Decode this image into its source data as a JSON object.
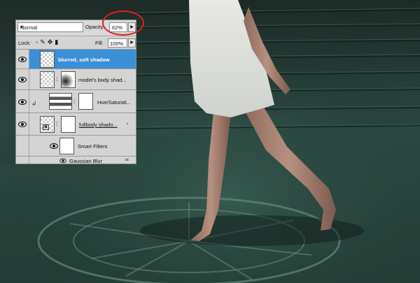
{
  "colors": {
    "selection": "#3b8fd6",
    "panel_bg": "#d4d4d4",
    "annotation": "#e0201b",
    "scene_dark": "#182622",
    "scene_teal": "#3f6b5e"
  },
  "toolbar": {
    "blend_mode": "Normal",
    "opacity_label": "Opacity:",
    "opacity_value": "62%",
    "lock_label": "Lock:",
    "fill_label": "Fill:",
    "fill_value": "100%"
  },
  "layers": [
    {
      "name": "blurred, soft shadow",
      "selected": true,
      "visible": true
    },
    {
      "name": "model's body shad...",
      "selected": false,
      "visible": true
    },
    {
      "name": "Hue/Saturati...",
      "selected": false,
      "visible": true
    },
    {
      "name": "fullbody shado...",
      "selected": false,
      "visible": true
    },
    {
      "name": "Smart Filters",
      "selected": false,
      "visible": true
    },
    {
      "name": "Gaussian Blur",
      "selected": false,
      "visible": true
    }
  ],
  "icons": {
    "lock_icons": [
      "lock-transparent-icon",
      "lock-paint-icon",
      "lock-move-icon",
      "lock-all-icon"
    ],
    "eye": "eye-icon",
    "chain": "chain-link-icon",
    "filter_options": "filter-options-icon",
    "smart_object": "smart-object-badge-icon"
  }
}
